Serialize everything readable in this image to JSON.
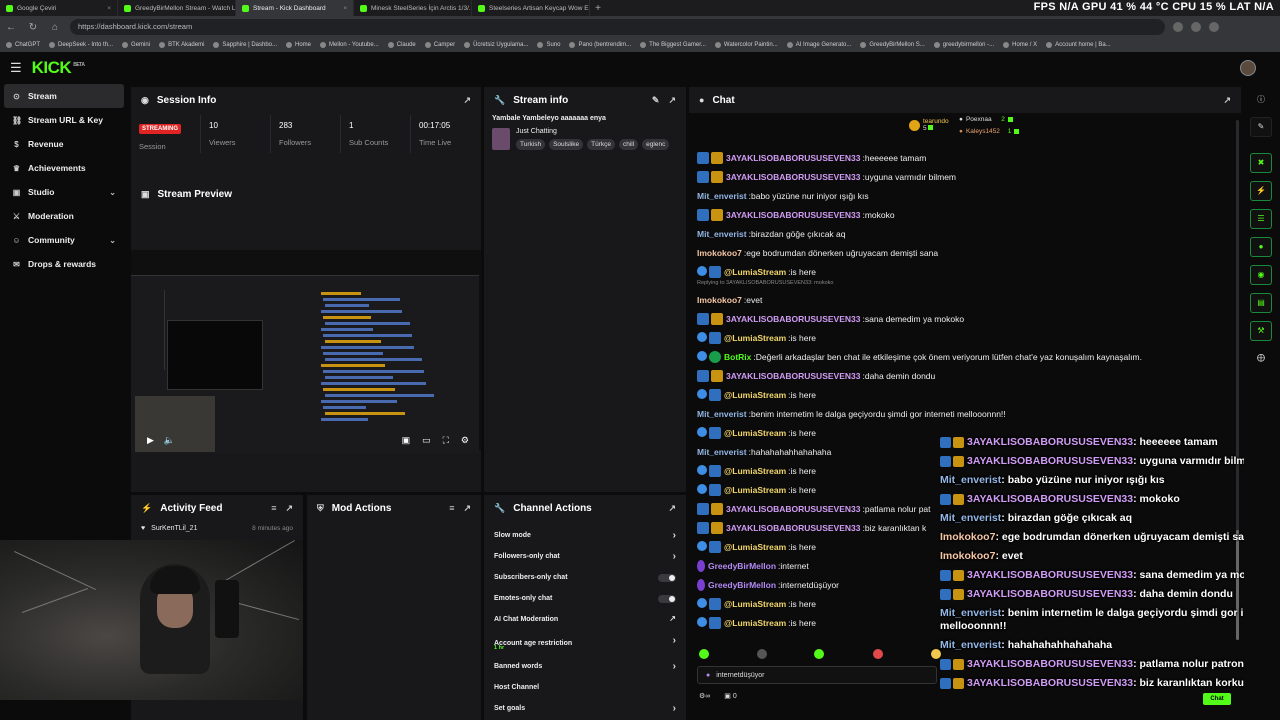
{
  "browser": {
    "tabs": [
      {
        "title": "Google Çeviri",
        "active": false
      },
      {
        "title": "GreedyBirMellon Stream - Watch Li",
        "active": false
      },
      {
        "title": "Stream - Kick Dashboard",
        "active": true
      },
      {
        "title": "Minesk SteelSeries İçin Arctis 1/3/...",
        "active": false
      },
      {
        "title": "Steelseries Artisan Keycap Wow E...",
        "active": false
      }
    ],
    "new_tab": "+",
    "hud": "FPS N/A  GPU 41 % 44 °C  CPU 15 %  LAT N/A",
    "url": "https://dashboard.kick.com/stream",
    "bookmarks": [
      "ChatGPT",
      "DeepSeek - Into th...",
      "Gemini",
      "BTK Akademi",
      "Sapphire | Dashbo...",
      "Home",
      "Mellon - Youtube...",
      "Claude",
      "Camper",
      "Ücretsiz Uygulama...",
      "Suno",
      "Pano (bentrendim...",
      "The Biggest Gamer...",
      "Watercolor Paintin...",
      "AI Image Generato...",
      "GreedyBirMellon S...",
      "greedybirmellon -...",
      "Home / X",
      "Account home | Ba..."
    ]
  },
  "header": {
    "logo": "KICK",
    "logo_badge": "BETA"
  },
  "sidebar": {
    "items": [
      {
        "label": "Stream",
        "icon": "broadcast-icon"
      },
      {
        "label": "Stream URL & Key",
        "icon": "link-icon"
      },
      {
        "label": "Revenue",
        "icon": "money-icon"
      },
      {
        "label": "Achievements",
        "icon": "trophy-icon"
      },
      {
        "label": "Studio",
        "icon": "studio-icon"
      },
      {
        "label": "Moderation",
        "icon": "shield-icon"
      },
      {
        "label": "Community",
        "icon": "people-icon"
      },
      {
        "label": "Drops & rewards",
        "icon": "gift-icon"
      }
    ]
  },
  "session": {
    "title": "Session Info",
    "badge": "STREAMING",
    "badge_label": "Session",
    "stats": [
      {
        "value": "10",
        "label": "Viewers"
      },
      {
        "value": "283",
        "label": "Followers"
      },
      {
        "value": "1",
        "label": "Sub Counts"
      },
      {
        "value": "00:17:05",
        "label": "Time Live"
      }
    ]
  },
  "preview": {
    "title": "Stream Preview"
  },
  "stream_info": {
    "title": "Stream info",
    "stream_title": "Yambale Yambeleyo aaaaaaa enya",
    "category": "Just Chatting",
    "tags": [
      "Turkish",
      "Soulslike",
      "Türkçe",
      "chill",
      "eglenc"
    ]
  },
  "activity": {
    "title": "Activity Feed",
    "items": [
      {
        "user": "SurKenTLil_21",
        "time": "8 minutes ago"
      }
    ]
  },
  "mod": {
    "title": "Mod Actions"
  },
  "channel": {
    "title": "Channel Actions",
    "actions": [
      {
        "label": "Slow mode",
        "control": "chevron"
      },
      {
        "label": "Followers-only chat",
        "control": "chevron"
      },
      {
        "label": "Subscribers-only chat",
        "control": "toggle"
      },
      {
        "label": "Emotes-only chat",
        "control": "toggle"
      },
      {
        "label": "AI Chat Moderation",
        "control": "external"
      },
      {
        "label": "Account age restriction",
        "control": "chevron",
        "sub": "1 hr"
      },
      {
        "label": "Banned words",
        "control": "chevron"
      },
      {
        "label": "Host Channel",
        "control": "none"
      },
      {
        "label": "Set goals",
        "control": "chevron"
      }
    ]
  },
  "chat": {
    "title": "Chat",
    "ranking": [
      {
        "name": "tearundo",
        "score": "5"
      },
      {
        "name": "Poexnaa",
        "score": "2"
      },
      {
        "name": "Kaleys1452",
        "score": "1"
      }
    ],
    "messages": [
      {
        "user": "3AYAKLISOBABORUSUSEVEN33",
        "text": "heeeeee tamam",
        "color": "#d19cf5",
        "badges": [
          "blue",
          "gold"
        ]
      },
      {
        "user": "3AYAKLISOBABORUSUSEVEN33",
        "text": "uyguna varmıdır bilmem",
        "color": "#d19cf5",
        "badges": [
          "blue",
          "gold"
        ]
      },
      {
        "user": "Mit_enverist",
        "text": "babo yüzüne nur iniyor ışığı kıs",
        "color": "#93b7e6",
        "badges": []
      },
      {
        "user": "3AYAKLISOBABORUSUSEVEN33",
        "text": "mokoko",
        "color": "#d19cf5",
        "badges": [
          "blue",
          "gold"
        ]
      },
      {
        "user": "Mit_enverist",
        "text": "birazdan göğe çıkıcak aq",
        "color": "#93b7e6",
        "badges": []
      },
      {
        "user": "Imokokoo7",
        "text": "ege bodrumdan dönerken uğruyacam demişti sana",
        "color": "#f5c6a4",
        "badges": []
      },
      {
        "user": "@LumiaStream",
        "text": "is here",
        "color": "#f2d66b",
        "badges": [
          "bot",
          "blue"
        ]
      },
      {
        "user": "Imokokoo7",
        "text": "evet",
        "color": "#f5c6a4",
        "badges": [],
        "reply": "Replying to 3AYAKLISOBABORUSUSEVEN33: mokoko"
      },
      {
        "user": "3AYAKLISOBABORUSUSEVEN33",
        "text": "sana demedim ya mokoko",
        "color": "#d19cf5",
        "badges": [
          "blue",
          "gold"
        ]
      },
      {
        "user": "@LumiaStream",
        "text": "is here",
        "color": "#f2d66b",
        "badges": [
          "bot",
          "blue"
        ]
      },
      {
        "user": "BotRix",
        "text": "Değerli arkadaşlar ben chat ile etkileşime çok önem veriyorum lütfen chat'e yaz konuşalım kaynaşalım.",
        "color": "#53fc18",
        "badges": [
          "bot",
          "green"
        ]
      },
      {
        "user": "3AYAKLISOBABORUSUSEVEN33",
        "text": "daha demin dondu",
        "color": "#d19cf5",
        "badges": [
          "blue",
          "gold"
        ]
      },
      {
        "user": "@LumiaStream",
        "text": "is here",
        "color": "#f2d66b",
        "badges": [
          "bot",
          "blue"
        ]
      },
      {
        "user": "Mit_enverist",
        "text": "benim internetim le dalga geçiyordu şimdi gor interneti mellooonnn!!",
        "color": "#93b7e6",
        "badges": []
      },
      {
        "user": "@LumiaStream",
        "text": "is here",
        "color": "#f2d66b",
        "badges": [
          "bot",
          "blue"
        ]
      },
      {
        "user": "Mit_enverist",
        "text": "hahahahahhahahaha",
        "color": "#93b7e6",
        "badges": []
      },
      {
        "user": "@LumiaStream",
        "text": "is here",
        "color": "#f2d66b",
        "badges": [
          "bot",
          "blue"
        ]
      },
      {
        "user": "@LumiaStream",
        "text": "is here",
        "color": "#f2d66b",
        "badges": [
          "bot",
          "blue"
        ]
      },
      {
        "user": "3AYAKLISOBABORUSUSEVEN33",
        "text": "patlama nolur pat",
        "color": "#d19cf5",
        "badges": [
          "blue",
          "gold"
        ]
      },
      {
        "user": "3AYAKLISOBABORUSUSEVEN33",
        "text": "biz karanlıktan k",
        "color": "#d19cf5",
        "badges": [
          "blue",
          "gold"
        ]
      },
      {
        "user": "@LumiaStream",
        "text": "is here",
        "color": "#f2d66b",
        "badges": [
          "bot",
          "blue"
        ]
      },
      {
        "user": "GreedyBirMellon",
        "text": "internet",
        "color": "#b48af5",
        "badges": [
          "purple"
        ]
      },
      {
        "user": "GreedyBirMellon",
        "text": "internetdüşüyor",
        "color": "#b48af5",
        "badges": [
          "purple"
        ]
      },
      {
        "user": "@LumiaStream",
        "text": "is here",
        "color": "#f2d66b",
        "badges": [
          "bot",
          "blue"
        ]
      },
      {
        "user": "@LumiaStream",
        "text": "is here",
        "color": "#f2d66b",
        "badges": [
          "bot",
          "blue"
        ]
      }
    ],
    "overlay": [
      {
        "user": "3AYAKLISOBABORUSUSEVEN33",
        "text": ": heeeeee tamam",
        "color": "#d19cf5",
        "badges": [
          "blue",
          "gold"
        ]
      },
      {
        "user": "3AYAKLISOBABORUSUSEVEN33",
        "text": ": uyguna varmıdır bilmem",
        "color": "#d19cf5",
        "badges": [
          "blue",
          "gold"
        ]
      },
      {
        "user": "Mit_enverist",
        "text": ": babo yüzüne nur iniyor ışığı kıs",
        "color": "#93b7e6",
        "badges": []
      },
      {
        "user": "3AYAKLISOBABORUSUSEVEN33",
        "text": ": mokoko",
        "color": "#d19cf5",
        "badges": [
          "blue",
          "gold"
        ]
      },
      {
        "user": "Mit_enverist",
        "text": ": birazdan göğe çıkıcak aq",
        "color": "#93b7e6",
        "badges": []
      },
      {
        "user": "Imokokoo7",
        "text": ": ege bodrumdan dönerken uğruyacam demişti sana",
        "color": "#f5c6a4",
        "badges": []
      },
      {
        "user": "Imokokoo7",
        "text": ": evet",
        "color": "#f5c6a4",
        "badges": []
      },
      {
        "user": "3AYAKLISOBABORUSUSEVEN33",
        "text": ": sana demedim ya mokoko",
        "color": "#d19cf5",
        "badges": [
          "blue",
          "gold"
        ]
      },
      {
        "user": "3AYAKLISOBABORUSUSEVEN33",
        "text": ": daha demin dondu",
        "color": "#d19cf5",
        "badges": [
          "blue",
          "gold"
        ]
      },
      {
        "user": "Mit_enverist",
        "text": ": benim internetim le dalga geçiyordu şimdi gor internet",
        "color": "#93b7e6",
        "badges": []
      },
      {
        "user": "",
        "text": "mellooonnn!!",
        "color": "#ffffff",
        "badges": []
      },
      {
        "user": "Mit_enverist",
        "text": ": hahahahahhahahaha",
        "color": "#93b7e6",
        "badges": []
      },
      {
        "user": "3AYAKLISOBABORUSUSEVEN33",
        "text": ": patlama nolur patron",
        "color": "#d19cf5",
        "badges": [
          "blue",
          "gold"
        ]
      },
      {
        "user": "3AYAKLISOBABORUSUSEVEN33",
        "text": ": biz karanlıktan korkuyoruz",
        "color": "#d19cf5",
        "badges": [
          "blue",
          "gold"
        ]
      }
    ],
    "input_value": "internetdüşüyor",
    "send_label": "Chat",
    "footer_count": "0"
  }
}
